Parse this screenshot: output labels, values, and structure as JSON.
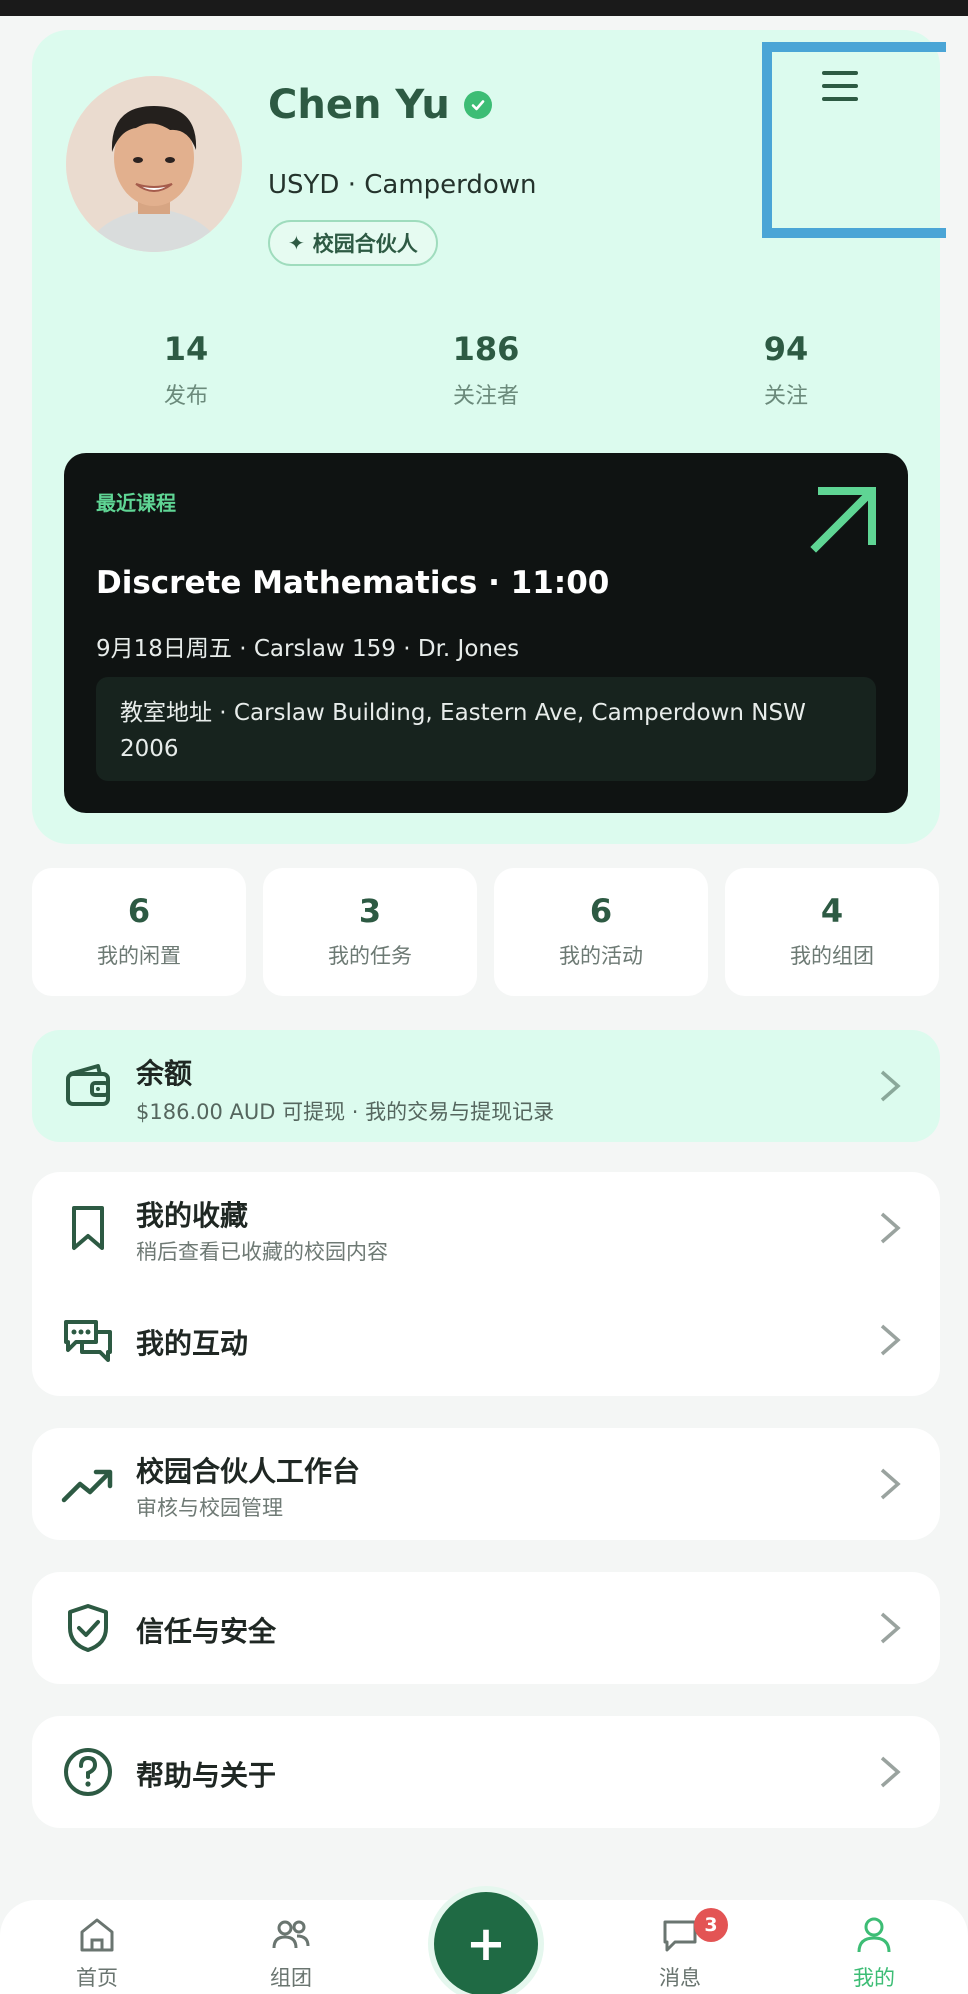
{
  "profile": {
    "name": "Chen Yu",
    "school": "USYD · Camperdown",
    "badge": "校园合伙人",
    "stats": [
      {
        "value": "14",
        "label": "发布"
      },
      {
        "value": "186",
        "label": "关注者"
      },
      {
        "value": "94",
        "label": "关注"
      }
    ]
  },
  "course": {
    "eyebrow": "最近课程",
    "title": "Discrete Mathematics · 11:00",
    "meta": "9月18日周五 · Carslaw 159 · Dr. Jones",
    "address": "教室地址 · Carslaw Building, Eastern Ave, Camperdown NSW 2006"
  },
  "tiles": [
    {
      "value": "6",
      "label": "我的闲置"
    },
    {
      "value": "3",
      "label": "我的任务"
    },
    {
      "value": "6",
      "label": "我的活动"
    },
    {
      "value": "4",
      "label": "我的组团"
    }
  ],
  "balance": {
    "title": "余额",
    "subtitle": "$186.00 AUD 可提现 · 我的交易与提现记录"
  },
  "menu": {
    "favorites": {
      "title": "我的收藏",
      "subtitle": "稍后查看已收藏的校园内容"
    },
    "interactions": {
      "title": "我的互动"
    },
    "partner_workspace": {
      "title": "校园合伙人工作台",
      "subtitle": "审核与校园管理"
    },
    "trust_safety": {
      "title": "信任与安全"
    },
    "help_about": {
      "title": "帮助与关于"
    }
  },
  "nav": {
    "home": "首页",
    "groups": "组团",
    "add": "+",
    "messages": "消息",
    "messages_badge": "3",
    "me": "我的"
  },
  "colors": {
    "accent": "#3dbd75",
    "brand_dark": "#2d5a43",
    "card_bg": "#dcfbee",
    "highlight_frame": "#4aa5d6"
  }
}
